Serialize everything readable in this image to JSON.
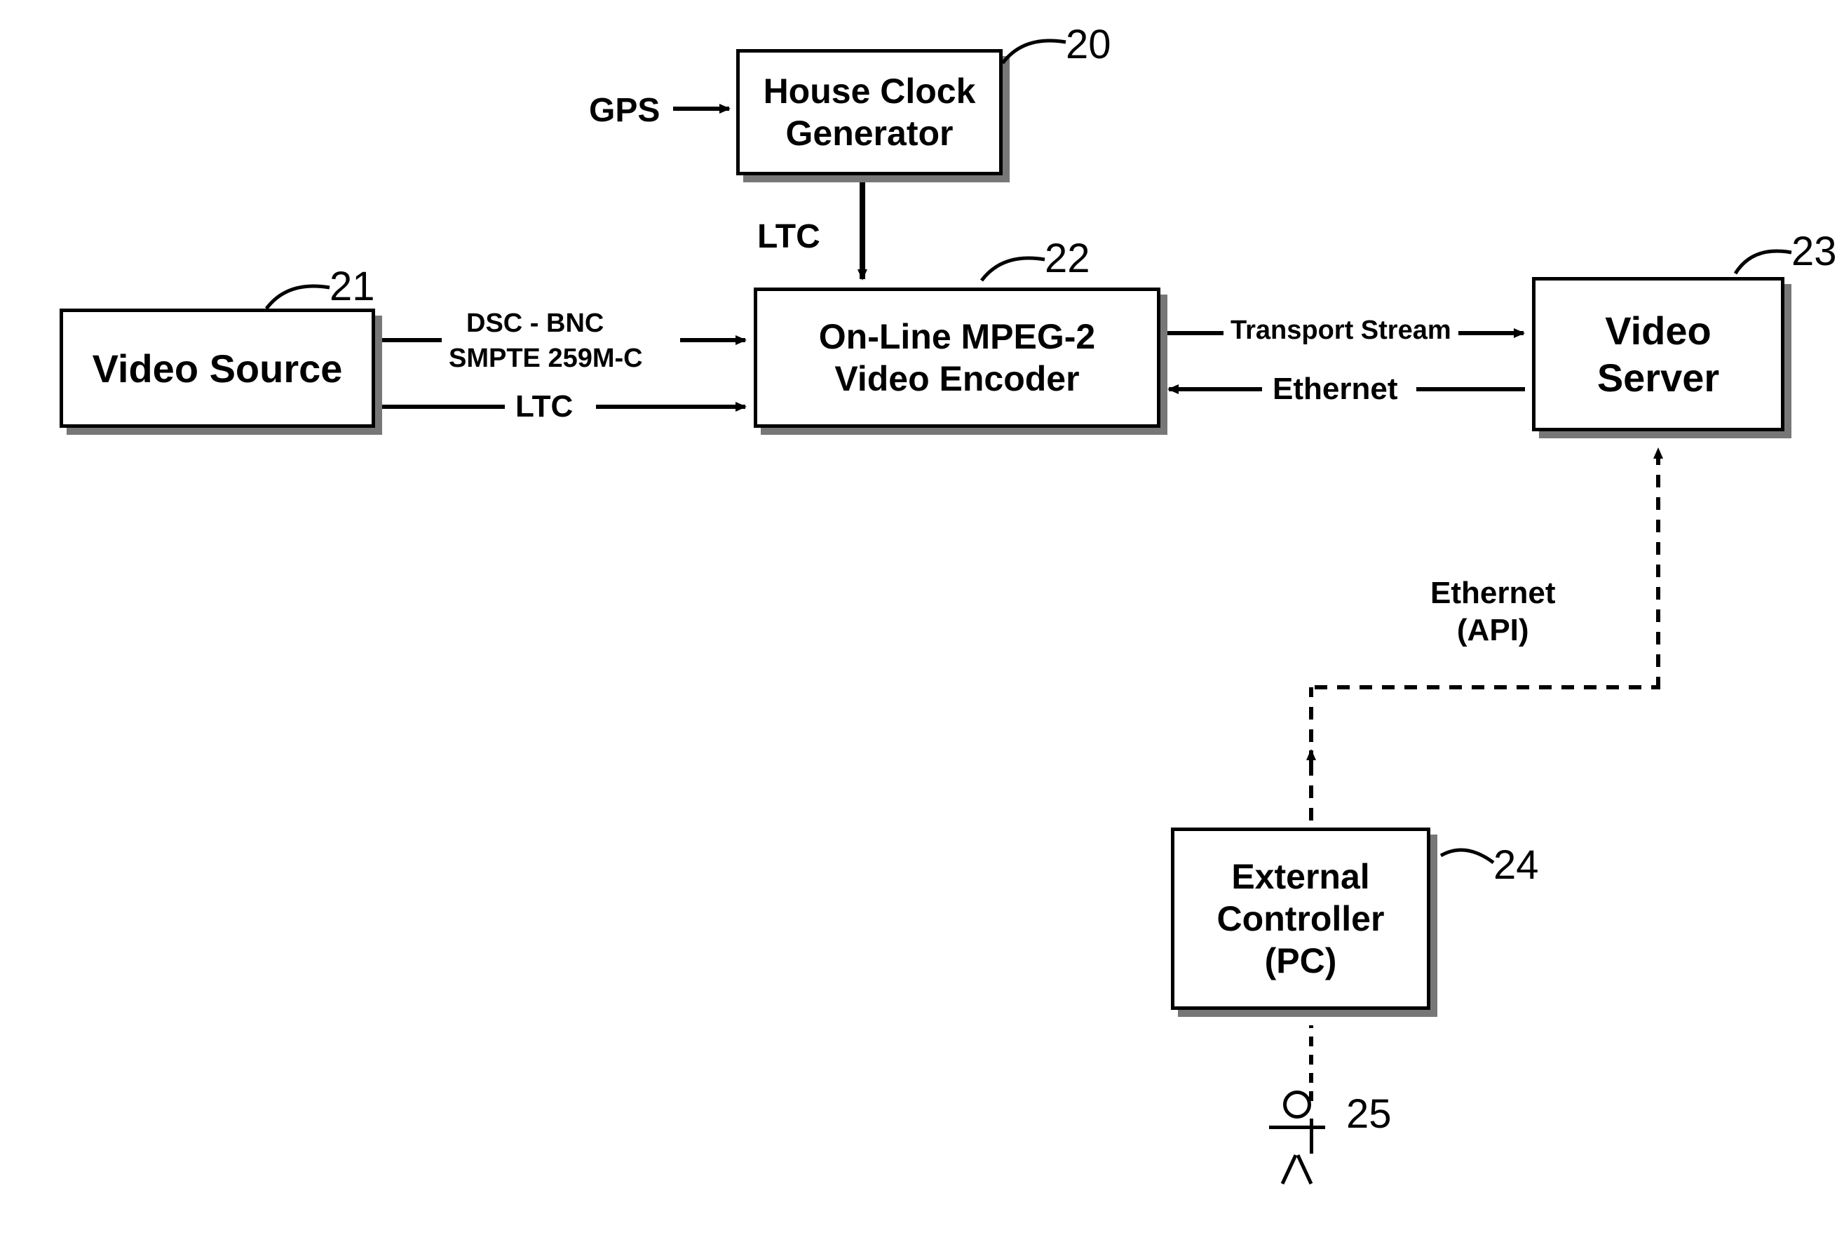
{
  "boxes": {
    "house_clock": {
      "label": "House Clock\nGenerator"
    },
    "video_source": {
      "label": "Video Source"
    },
    "video_encoder": {
      "label": "On-Line MPEG-2\nVideo Encoder"
    },
    "video_server": {
      "label": "Video\nServer"
    },
    "external_controller": {
      "label": "External\nController\n(PC)"
    }
  },
  "edges": {
    "gps": "GPS",
    "ltc1": "LTC",
    "dsc_bnc": "DSC - BNC",
    "smpte": "SMPTE 259M-C",
    "ltc2": "LTC",
    "transport": "Transport Stream",
    "ethernet": "Ethernet",
    "ethernet_api": {
      "line1": "Ethernet",
      "line2": "(API)"
    }
  },
  "refs": {
    "r20": "20",
    "r21": "21",
    "r22": "22",
    "r23": "23",
    "r24": "24",
    "r25": "25"
  }
}
